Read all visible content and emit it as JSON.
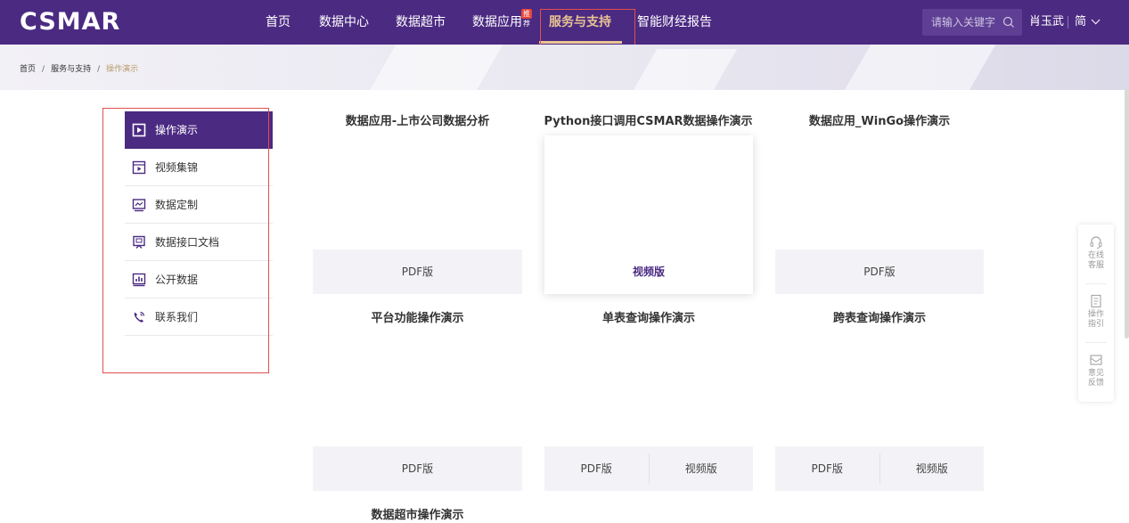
{
  "header": {
    "logo": "CSMAR",
    "nav": [
      {
        "label": "首页"
      },
      {
        "label": "数据中心"
      },
      {
        "label": "数据超市"
      },
      {
        "label": "数据应用",
        "badge": "推荐"
      },
      {
        "label": "服务与支持",
        "active": true
      },
      {
        "label": "智能财经报告"
      }
    ],
    "search_placeholder": "请输入关键字",
    "user_name": "肖玉武",
    "language": "简"
  },
  "breadcrumb": {
    "items": [
      "首页",
      "服务与支持"
    ],
    "current": "操作演示",
    "separator": "/"
  },
  "sidebar": {
    "items": [
      {
        "label": "操作演示",
        "icon": "play-square-icon",
        "active": true
      },
      {
        "label": "视频集锦",
        "icon": "video-collection-icon"
      },
      {
        "label": "数据定制",
        "icon": "monitor-chart-icon"
      },
      {
        "label": "数据接口文档",
        "icon": "api-doc-icon"
      },
      {
        "label": "公开数据",
        "icon": "bar-chart-icon"
      },
      {
        "label": "联系我们",
        "icon": "phone-icon"
      }
    ]
  },
  "cards": [
    {
      "title": "数据应用-上市公司数据分析",
      "buttons": [
        "PDF版"
      ]
    },
    {
      "title": "Python接口调用CSMAR数据操作演示",
      "buttons": [
        "视频版"
      ]
    },
    {
      "title": "数据应用_WinGo操作演示",
      "buttons": [
        "PDF版"
      ]
    },
    {
      "title": "平台功能操作演示",
      "buttons": [
        "PDF版"
      ]
    },
    {
      "title": "单表查询操作演示",
      "buttons": [
        "PDF版",
        "视频版"
      ]
    },
    {
      "title": "跨表查询操作演示",
      "buttons": [
        "PDF版",
        "视频版"
      ]
    },
    {
      "title": "数据超市操作演示",
      "buttons": []
    }
  ],
  "float_bar": [
    {
      "label_1": "在线",
      "label_2": "客服",
      "icon": "headset-icon"
    },
    {
      "label_1": "操作",
      "label_2": "指引",
      "icon": "guide-doc-icon"
    },
    {
      "label_1": "意见",
      "label_2": "反馈",
      "icon": "feedback-icon"
    }
  ],
  "colors": {
    "brand_purple": "#4b2a82",
    "active_gold": "#e9c493",
    "badge_red": "#e8443a",
    "highlight_box": "#e05050"
  }
}
